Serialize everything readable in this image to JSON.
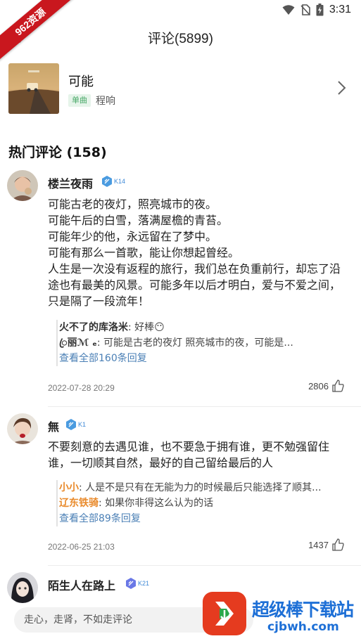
{
  "status_bar": {
    "time": "3:31"
  },
  "watermark": {
    "corner_text": "962资源"
  },
  "header": {
    "title": "评论(5899)"
  },
  "song": {
    "title": "可能",
    "type_badge": "单曲",
    "artist": "程响"
  },
  "hot_comments": {
    "heading": "热门评论 (158)"
  },
  "comments": [
    {
      "username": "楼兰夜雨",
      "level": "K14",
      "body": "可能古老的夜灯，照亮城市的夜。\n可能午后的白雪，落满屋檐的青苔。\n可能年少的他，永远留在了梦中。\n可能有那么一首歌，能让你想起曾经。\n人生是一次没有返程的旅行，我们总在负重前行，却忘了沿途也有最美的风景。可能多年以后才明白，爱与不爱之间，只是隔了一段流年！",
      "replies": [
        {
          "name": "火不了的库洛米",
          "text": "好棒😶"
        },
        {
          "name": "ꦿ丽ℳ ₑ",
          "text": "可能是古老的夜灯 照亮城市的夜，可能是..."
        }
      ],
      "view_all": "查看全部160条回复",
      "time": "2022-07-28 20:29",
      "likes": "2806"
    },
    {
      "username": "無",
      "level": "K1",
      "body": "不要刻意的去遇见谁，也不要急于拥有谁，更不勉强留住谁，一切顺其自然，最好的自己留给最后的人",
      "replies": [
        {
          "name": "小小",
          "text": "人是不是只有在无能为力的时候最后只能选择了顺其..."
        },
        {
          "name": "辽东铁骑",
          "text": "如果你非得这么认为的话"
        }
      ],
      "view_all": "查看全部89条回复",
      "time": "2022-06-25 21:03",
      "likes": "1437"
    },
    {
      "username": "陌生人在路上",
      "level": "K21"
    }
  ],
  "input": {
    "placeholder": "走心，走肾，不如走评论"
  },
  "site_watermark": {
    "title": "超级棒下载站",
    "url": "cjbwh.com"
  },
  "colors": {
    "accent_green": "#48a867",
    "link_blue": "#4a7fb5",
    "reply_orange": "#e98a2b",
    "badge_blue": "#3e89d7"
  }
}
